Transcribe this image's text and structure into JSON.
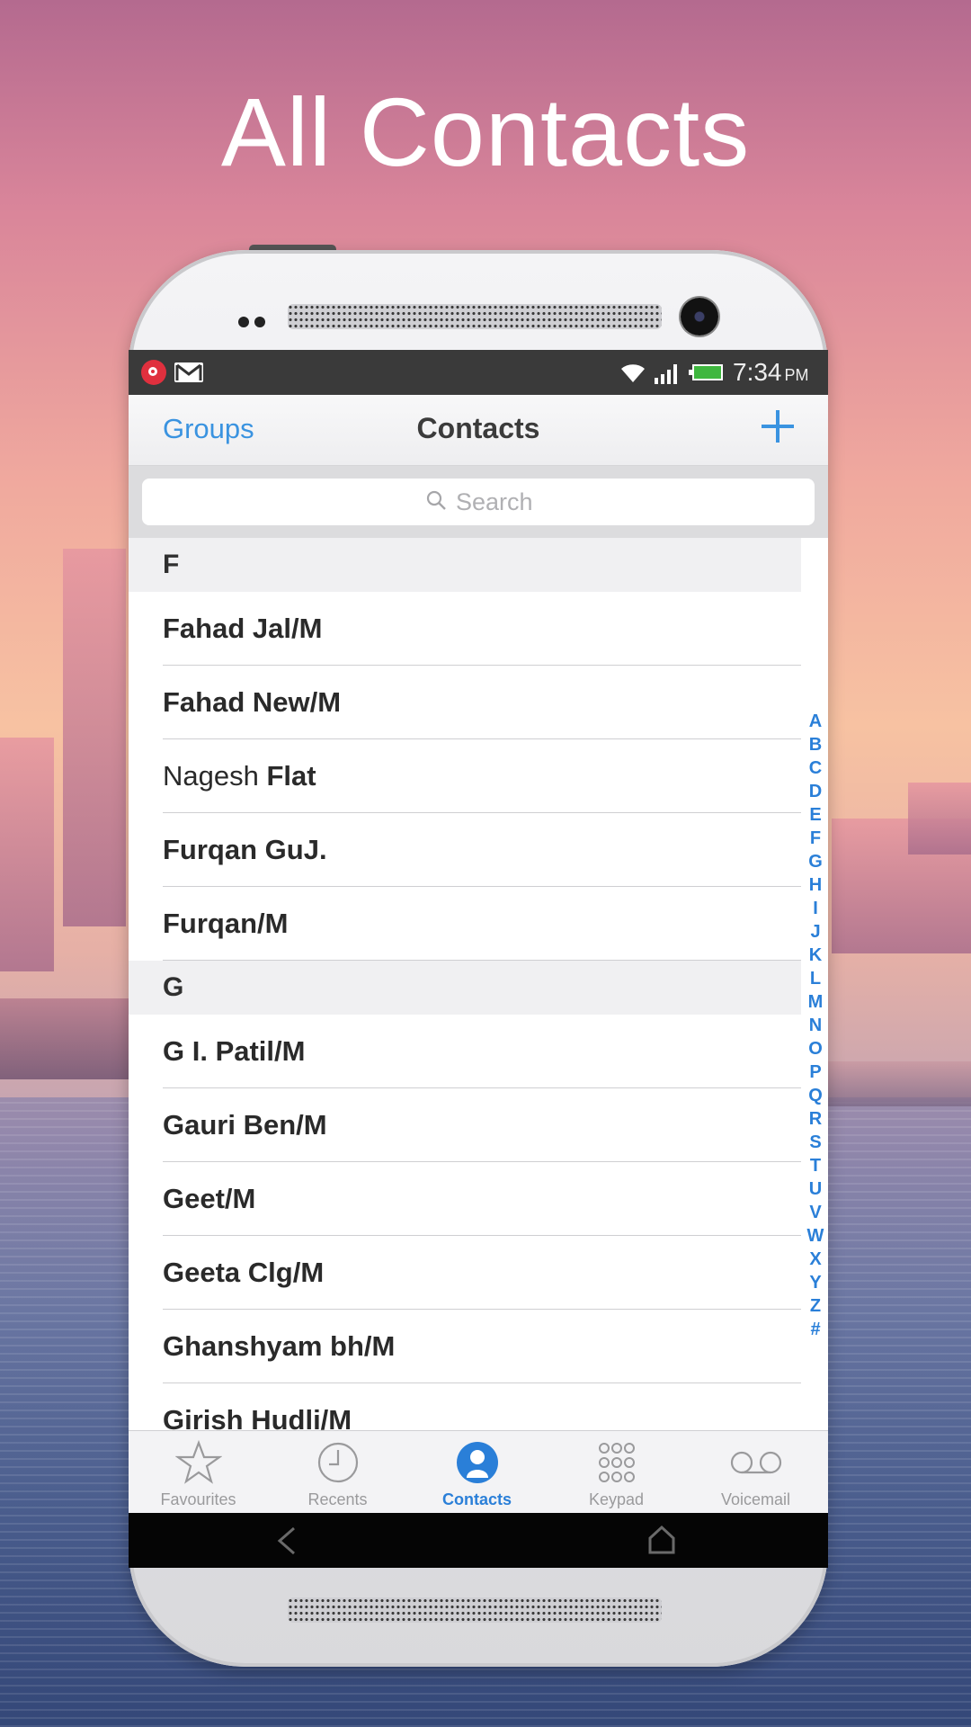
{
  "headline": "All Contacts",
  "status_bar": {
    "time": "7:34",
    "ampm": "PM"
  },
  "navbar": {
    "left_label": "Groups",
    "title": "Contacts"
  },
  "search": {
    "placeholder": "Search"
  },
  "sections": [
    {
      "letter": "F",
      "contacts": [
        {
          "first": "",
          "last": "Fahad Jal/M"
        },
        {
          "first": "",
          "last": "Fahad New/M"
        },
        {
          "first": "Nagesh",
          "last": "Flat"
        },
        {
          "first": "",
          "last": "Furqan GuJ."
        },
        {
          "first": "",
          "last": "Furqan/M"
        }
      ]
    },
    {
      "letter": "G",
      "contacts": [
        {
          "first": "",
          "last": "G I. Patil/M"
        },
        {
          "first": "",
          "last": "Gauri Ben/M"
        },
        {
          "first": "",
          "last": "Geet/M"
        },
        {
          "first": "",
          "last": "Geeta Clg/M"
        },
        {
          "first": "",
          "last": "Ghanshyam bh/M"
        },
        {
          "first": "",
          "last": "Girish Hudli/M"
        }
      ]
    }
  ],
  "index_letters": [
    "A",
    "B",
    "C",
    "D",
    "E",
    "F",
    "G",
    "H",
    "I",
    "J",
    "K",
    "L",
    "M",
    "N",
    "O",
    "P",
    "Q",
    "R",
    "S",
    "T",
    "U",
    "V",
    "W",
    "X",
    "Y",
    "Z",
    "#"
  ],
  "tabs": [
    {
      "label": "Favourites",
      "icon": "star-icon",
      "active": false
    },
    {
      "label": "Recents",
      "icon": "clock-icon",
      "active": false
    },
    {
      "label": "Contacts",
      "icon": "person-icon",
      "active": true
    },
    {
      "label": "Keypad",
      "icon": "keypad-icon",
      "active": false
    },
    {
      "label": "Voicemail",
      "icon": "voicemail-icon",
      "active": false
    }
  ],
  "colors": {
    "accent": "#2a7fd8",
    "battery": "#3fb73f",
    "beats": "#e0303e"
  }
}
